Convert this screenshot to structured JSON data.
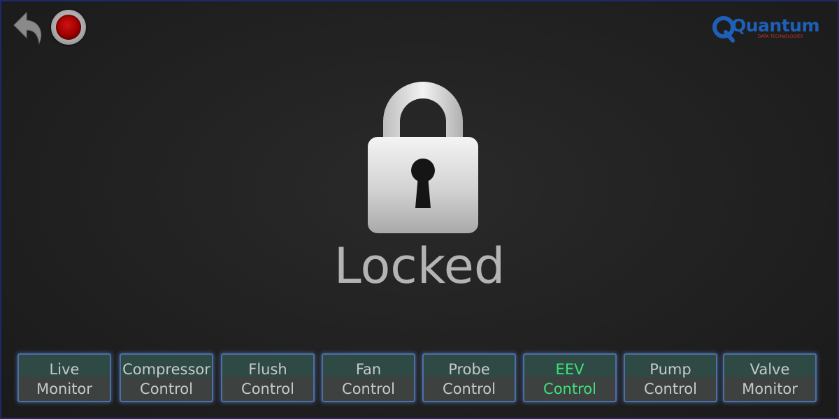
{
  "header": {
    "back_icon": "undo-arrow-icon",
    "record_icon": "red-record-button-icon",
    "logo": {
      "word": "Quantum",
      "subtitle": "DATA TECHNOLOGIES"
    }
  },
  "main": {
    "lock_icon": "padlock-icon",
    "status": "Locked"
  },
  "nav": {
    "items": [
      {
        "line1": "Live",
        "line2": "Monitor"
      },
      {
        "line1": "Compressor",
        "line2": "Control"
      },
      {
        "line1": "Flush",
        "line2": "Control"
      },
      {
        "line1": "Fan",
        "line2": "Control"
      },
      {
        "line1": "Probe",
        "line2": "Control"
      },
      {
        "line1": "EEV",
        "line2": "Control",
        "active": true
      },
      {
        "line1": "Pump",
        "line2": "Control"
      },
      {
        "line1": "Valve",
        "line2": "Monitor"
      }
    ]
  },
  "colors": {
    "background": "#222222",
    "active_text": "#3ee07a",
    "button_border": "#4c6fa8",
    "logo_blue": "#1e5fb8",
    "logo_red": "#c0392b"
  }
}
